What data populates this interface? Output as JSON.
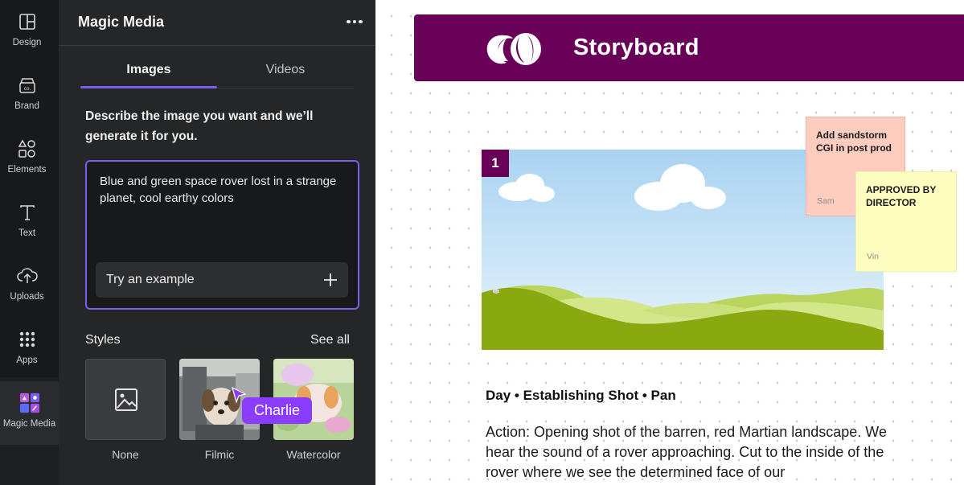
{
  "rail": {
    "items": [
      {
        "label": "Design",
        "icon": "design-icon"
      },
      {
        "label": "Brand",
        "icon": "brand-icon"
      },
      {
        "label": "Elements",
        "icon": "elements-icon"
      },
      {
        "label": "Text",
        "icon": "text-icon"
      },
      {
        "label": "Uploads",
        "icon": "uploads-icon"
      },
      {
        "label": "Apps",
        "icon": "apps-icon"
      },
      {
        "label": "Magic Media",
        "icon": "magic-media-icon"
      }
    ]
  },
  "panel": {
    "title": "Magic Media",
    "tabs": [
      {
        "label": "Images"
      },
      {
        "label": "Videos"
      }
    ],
    "description": "Describe the image you want and we’ll generate it for you.",
    "prompt": "Blue and green space rover lost in a strange planet, cool earthy colors",
    "try_example": "Try an example",
    "styles_label": "Styles",
    "see_all": "See all",
    "styles": [
      {
        "name": "None"
      },
      {
        "name": "Filmic"
      },
      {
        "name": "Watercolor"
      }
    ],
    "collaborator": "Charlie"
  },
  "canvas": {
    "banner_title": "Storyboard",
    "scene_number": "1",
    "notes": [
      {
        "text": "Add sandstorm CGI in post prod",
        "author": "Sam"
      },
      {
        "text": "APPROVED BY DIRECTOR",
        "author": "Vin"
      }
    ],
    "shot_title": "Day • Establishing Shot • Pan",
    "action": "Action: Opening shot of the barren, red Martian landscape. We hear the sound of a rover approaching. Cut to the inside of the rover where we see the determined face of our"
  },
  "colors": {
    "accent": "#7d5cf0",
    "brand": "#690058",
    "collaborator": "#8b3dff"
  }
}
